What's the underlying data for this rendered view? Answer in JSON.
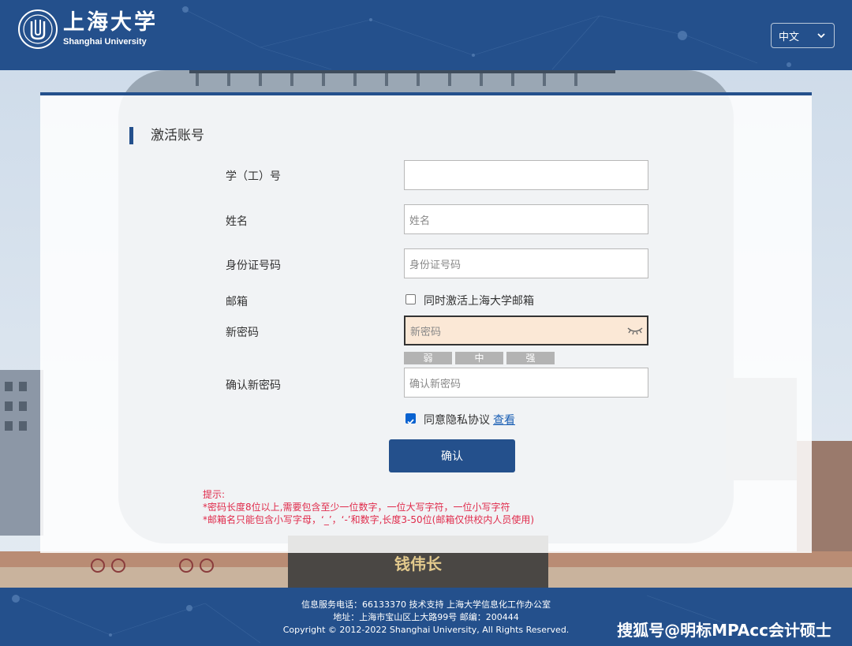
{
  "header": {
    "logo_cn": "上海大学",
    "logo_en": "Shanghai University",
    "language": "中文"
  },
  "scene": {
    "statue_plaque": "钱伟长"
  },
  "form": {
    "title": "激活账号",
    "student_id_label": "学（工）号",
    "student_id_value": "",
    "name_label": "姓名",
    "name_placeholder": "姓名",
    "id_card_label": "身份证号码",
    "id_card_placeholder": "身份证号码",
    "email_label": "邮箱",
    "email_checkbox_label": "同时激活上海大学邮箱",
    "email_checkbox_checked": false,
    "new_password_label": "新密码",
    "new_password_placeholder": "新密码",
    "strength_levels": [
      "弱",
      "中",
      "强"
    ],
    "confirm_password_label": "确认新密码",
    "confirm_password_placeholder": "确认新密码",
    "privacy_label": "同意隐私协议",
    "privacy_checked": true,
    "privacy_link": "查看",
    "submit_label": "确认"
  },
  "tips": {
    "heading": "提示:",
    "line1": "*密码长度8位以上,需要包含至少一位数字，一位大写字符，一位小写字符",
    "line2": "*邮箱名只能包含小写字母，‘_’，‘-’和数字,长度3-50位(邮箱仅供校内人员使用)"
  },
  "footer": {
    "line1": "信息服务电话：66133370 技术支持 上海大学信息化工作办公室",
    "line2": "地址：上海市宝山区上大路99号 邮编：200444",
    "line3": "Copyright © 2012-2022 Shanghai University, All Rights Reserved.",
    "watermark": "搜狐号@明标MPAcc会计硕士"
  },
  "colors": {
    "brand_blue": "#24508c",
    "tip_red": "#e02b4b",
    "link_blue": "#1a5fb4"
  }
}
